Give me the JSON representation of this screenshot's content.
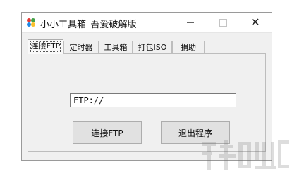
{
  "window": {
    "title": "小小工具箱_吾爱破解版"
  },
  "tabs": [
    {
      "label": "连接FTP"
    },
    {
      "label": "定时器"
    },
    {
      "label": "工具箱"
    },
    {
      "label": "打包ISO"
    },
    {
      "label": "捐助"
    }
  ],
  "ftp": {
    "address_value": "FTP://",
    "connect_label": "连接FTP",
    "exit_label": "退出程序"
  },
  "icons": {
    "app": "colorful-puzzle-icon",
    "minimize": "minimize-icon",
    "maximize": "maximize-icon",
    "close": "close-icon"
  }
}
